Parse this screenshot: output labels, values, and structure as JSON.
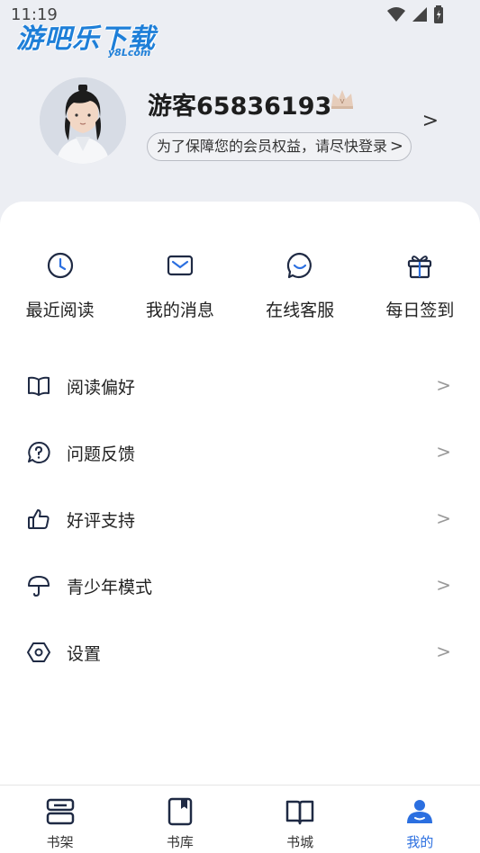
{
  "status": {
    "time": "11:19"
  },
  "watermark": {
    "title": "游吧乐下载",
    "sub": "y8Lcom"
  },
  "profile": {
    "username": "游客65836193",
    "login_hint": "为了保障您的会员权益，请尽快登录",
    "hint_chevron": ">",
    "arrow": ">"
  },
  "quick_actions": [
    {
      "label": "最近阅读",
      "icon": "clock-icon"
    },
    {
      "label": "我的消息",
      "icon": "envelope-icon"
    },
    {
      "label": "在线客服",
      "icon": "chat-smile-icon"
    },
    {
      "label": "每日签到",
      "icon": "gift-icon"
    }
  ],
  "menu": [
    {
      "label": "阅读偏好",
      "icon": "book-open-icon"
    },
    {
      "label": "问题反馈",
      "icon": "question-bubble-icon"
    },
    {
      "label": "好评支持",
      "icon": "thumbs-up-icon"
    },
    {
      "label": "青少年模式",
      "icon": "umbrella-icon"
    },
    {
      "label": "设置",
      "icon": "settings-icon"
    }
  ],
  "menu_chevron": ">",
  "tabs": [
    {
      "label": "书架",
      "icon": "bookshelf-icon",
      "active": false
    },
    {
      "label": "书库",
      "icon": "book-icon",
      "active": false
    },
    {
      "label": "书城",
      "icon": "book-open-icon",
      "active": false
    },
    {
      "label": "我的",
      "icon": "person-icon",
      "active": true
    }
  ],
  "colors": {
    "accent": "#2b6fe0",
    "icon_navy": "#1f2a44",
    "background": "#eceef3"
  }
}
